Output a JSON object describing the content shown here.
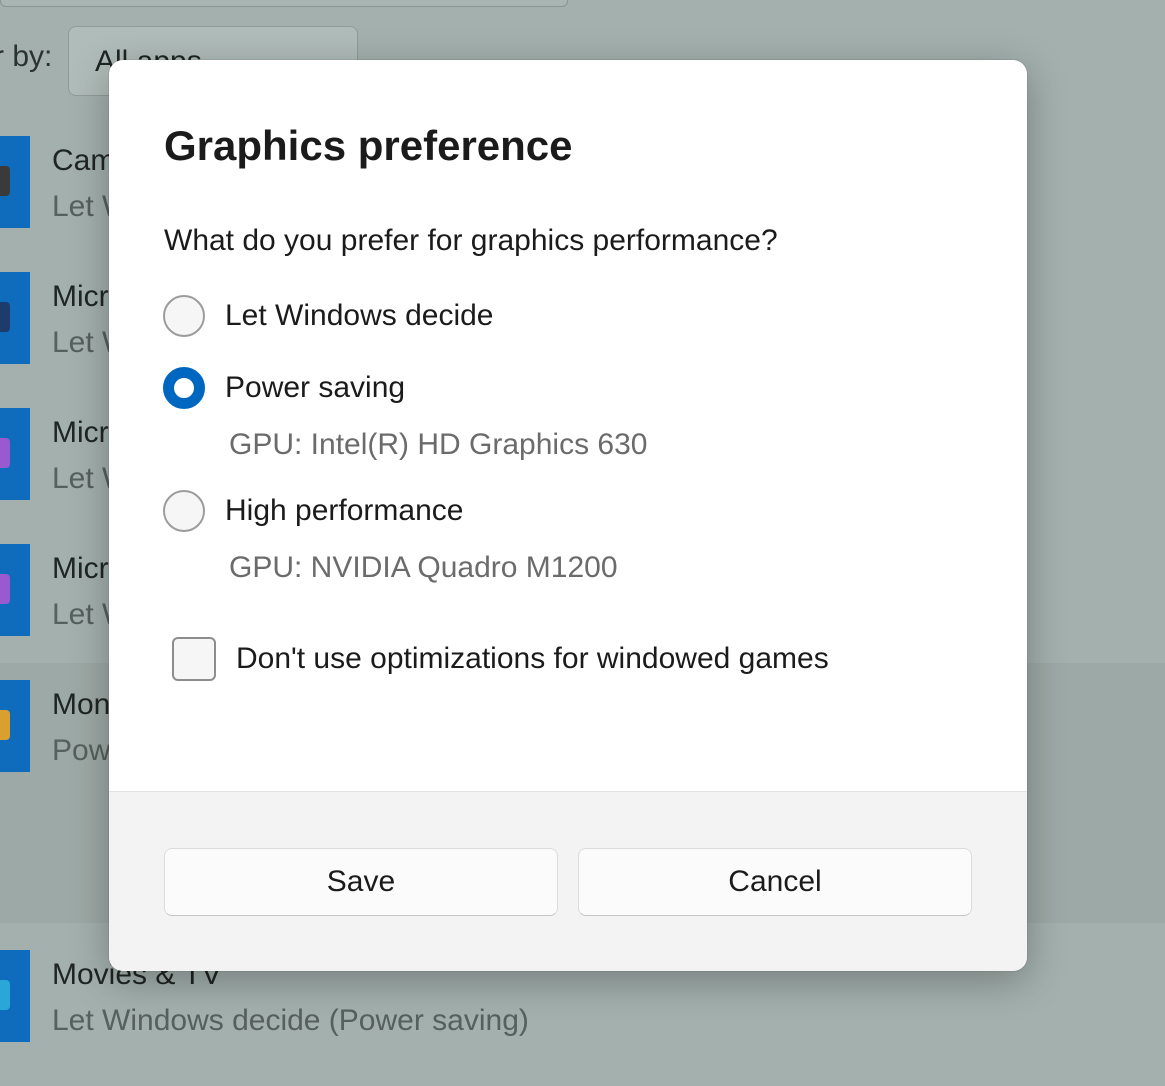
{
  "background": {
    "filter": {
      "label": "r by:",
      "value": "All apps"
    },
    "apps": [
      {
        "name": "Cam",
        "preference": "Let W",
        "icon": "camera-app-icon",
        "glyph_color": "#3a3a3a"
      },
      {
        "name": "Micr",
        "preference": "Let W",
        "icon": "microsoft-app-icon",
        "glyph_color": "#1d3b6b"
      },
      {
        "name": "Micr",
        "preference": "Let W",
        "icon": "microsoft-app-icon",
        "glyph_color": "#9b59d0"
      },
      {
        "name": "Micr",
        "preference": "Let W",
        "icon": "microsoft-app-icon",
        "glyph_color": "#9b59d0"
      },
      {
        "name": "Mon",
        "preference": "Pow",
        "icon": "app-icon",
        "glyph_color": "#d9a030"
      },
      {
        "name": "Movies & TV",
        "preference": "Let Windows decide (Power saving)",
        "icon": "movies-tv-app-icon",
        "glyph_color": "#2aa7d9"
      }
    ]
  },
  "dialog": {
    "title": "Graphics preference",
    "question": "What do you prefer for graphics performance?",
    "options": [
      {
        "label": "Let Windows decide",
        "checked": false,
        "gpu": ""
      },
      {
        "label": "Power saving",
        "checked": true,
        "gpu": "GPU: Intel(R) HD Graphics 630"
      },
      {
        "label": "High performance",
        "checked": false,
        "gpu": "GPU: NVIDIA Quadro M1200"
      }
    ],
    "checkbox": {
      "label": "Don't use optimizations for windowed games",
      "checked": false
    },
    "buttons": {
      "save": "Save",
      "cancel": "Cancel"
    }
  },
  "colors": {
    "accent": "#0067c0",
    "app_tile": "#0f6cbd",
    "overlay_background": "#a3b0ad"
  }
}
